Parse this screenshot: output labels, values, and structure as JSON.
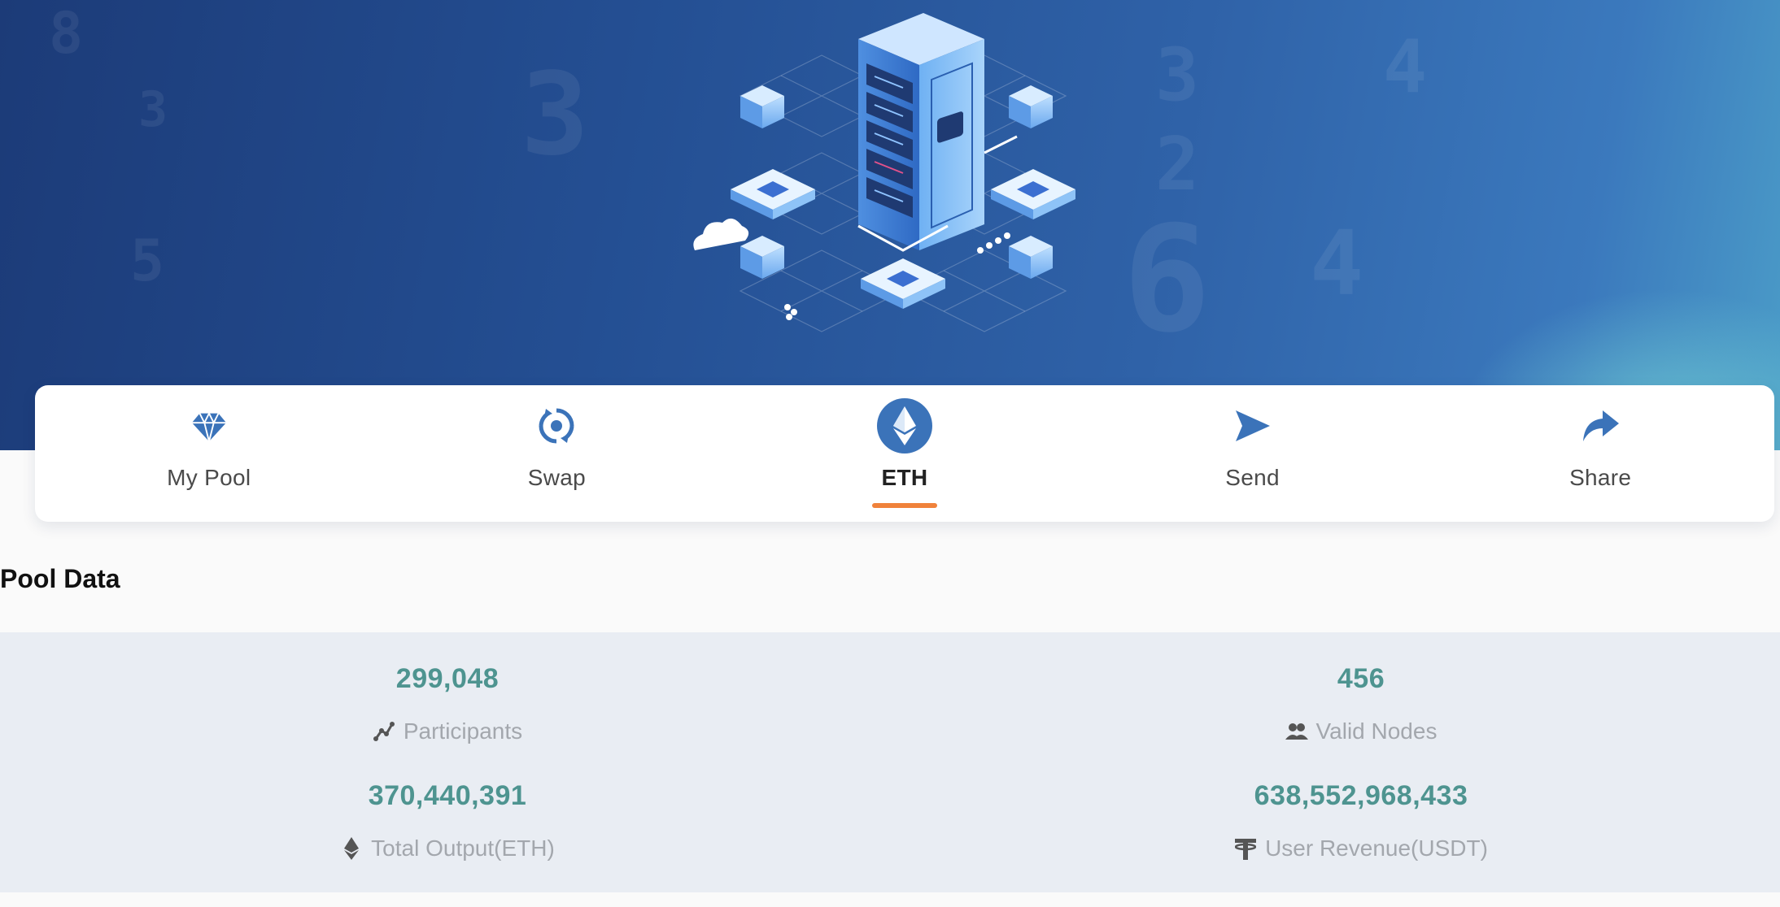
{
  "nav": {
    "items": [
      {
        "label": "My Pool",
        "icon": "diamond-icon"
      },
      {
        "label": "Swap",
        "icon": "swap-cycle-icon"
      },
      {
        "label": "ETH",
        "icon": "ethereum-icon",
        "active": true
      },
      {
        "label": "Send",
        "icon": "send-arrow-icon"
      },
      {
        "label": "Share",
        "icon": "share-arrow-icon"
      }
    ]
  },
  "pool": {
    "title": "Pool Data",
    "stats": [
      {
        "value": "299,048",
        "label": "Participants",
        "icon": "chart-line-icon"
      },
      {
        "value": "456",
        "label": "Valid Nodes",
        "icon": "users-icon"
      },
      {
        "value": "370,440,391",
        "label": "Total Output(ETH)",
        "icon": "ethereum-small-icon"
      },
      {
        "value": "638,552,968,433",
        "label": "User Revenue(USDT)",
        "icon": "tether-icon"
      }
    ]
  },
  "colors": {
    "accent": "#3b73b9",
    "active_underline": "#f0823b",
    "stat_value": "#4e9490",
    "stat_label": "#a3a7ad"
  }
}
